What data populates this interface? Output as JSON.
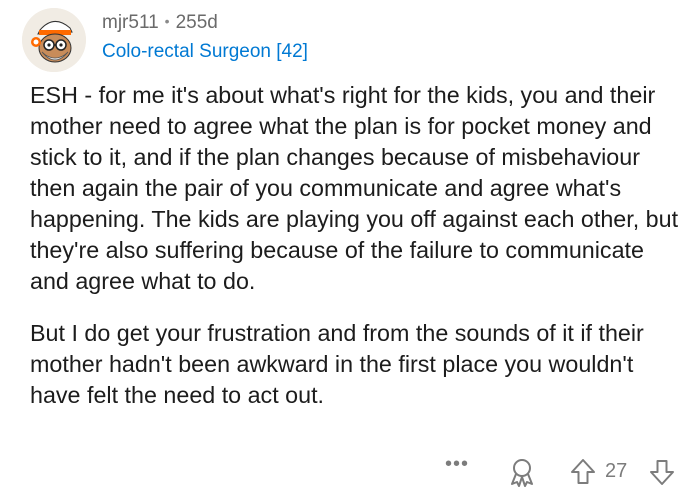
{
  "comment": {
    "author": "mjr511",
    "separator": "•",
    "age": "255d",
    "flair": "Colo-rectal Surgeon [42]",
    "paragraphs": [
      "ESH - for me it's about what's right for the kids, you and their mother need to agree what the plan is for pocket money and stick to it, and if the plan changes because of misbehaviour then again the pair of you communicate and agree what's happening. The kids are playing you off against each other, but they're also suffering because of the failure to communicate and agree what to do.",
      "But I do get your frustration and from the sounds of it if their mother hadn't been awkward in the first place you wouldn't have felt the need to act out."
    ],
    "actions": {
      "more_label": "•••",
      "score": "27"
    }
  },
  "icons": {
    "avatar": "snoo-avatar-icon",
    "more": "more-options-icon",
    "award": "award-icon",
    "upvote": "upvote-arrow-icon",
    "downvote": "downvote-arrow-icon"
  },
  "colors": {
    "flair": "#0079d3",
    "meta": "#7c7c7c",
    "text": "#1c1c1c",
    "avatar_accent": "#ff4500"
  }
}
